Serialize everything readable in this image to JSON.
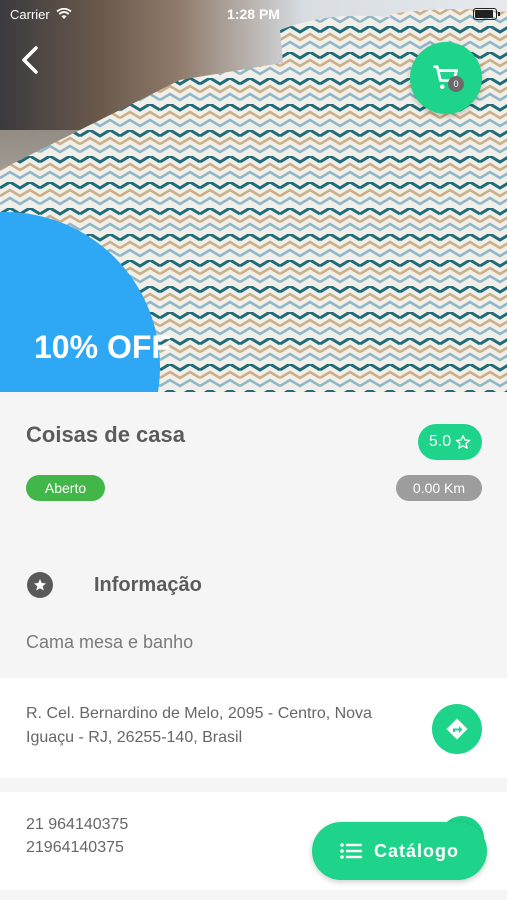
{
  "status_bar": {
    "carrier": "Carrier",
    "time": "1:28 PM"
  },
  "hero": {
    "promo_label": "10% OFF",
    "cart_count": "0"
  },
  "store": {
    "name": "Coisas de casa",
    "rating": "5.0",
    "status": "Aberto",
    "distance": "0.00 Km"
  },
  "info": {
    "title": "Informação",
    "description": "Cama mesa e banho"
  },
  "address": {
    "text": "R. Cel. Bernardino de Melo, 2095 - Centro, Nova Iguaçu - RJ, 26255-140, Brasil"
  },
  "phones": [
    "21 964140375",
    "21964140375"
  ],
  "catalog_button": {
    "label": "Catálogo"
  },
  "colors": {
    "accent_green": "#1ed38a",
    "open_green": "#43b649",
    "promo_blue": "#2ea8f5",
    "pill_gray": "#9d9d9d"
  },
  "icons": {
    "back": "chevron-left-icon",
    "cart": "shopping-cart-icon",
    "rating": "star-outline-icon",
    "info": "star-circle-icon",
    "directions": "directions-arrow-icon",
    "catalog": "list-icon"
  }
}
